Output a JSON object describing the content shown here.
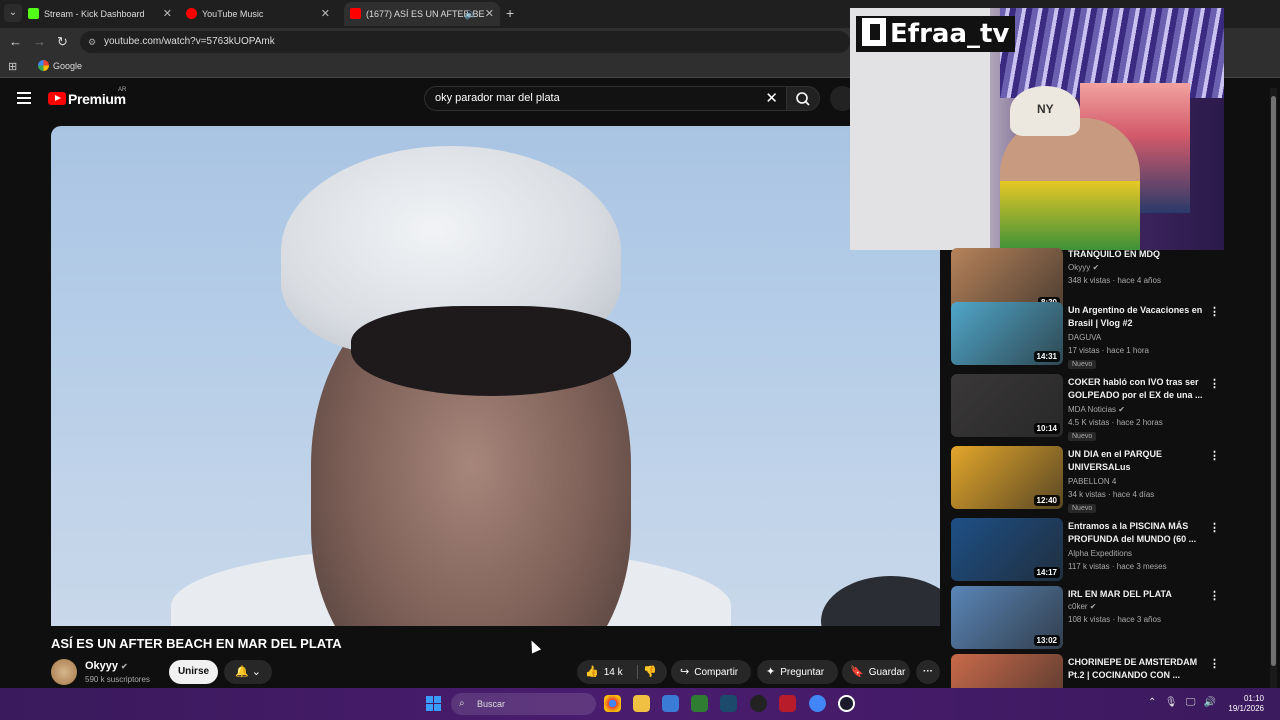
{
  "browser": {
    "tabs": [
      {
        "label": "Stream - Kick Dashboard",
        "color": "#53fc18"
      },
      {
        "label": "YouTube Music",
        "color": "#ff0000"
      },
      {
        "label": "(1677) ASÍ ES UN AFTER BE",
        "color": "#ff0000"
      }
    ],
    "url": "youtube.com/watch?v=5763kUOPAmk",
    "bookmark": "Google"
  },
  "youtube": {
    "logo_text": "Premium",
    "region": "AR",
    "search_query": "oky parador mar del plata"
  },
  "overlay": {
    "streamer_name": "Efraa_tv",
    "cap_logo": "NY"
  },
  "video": {
    "title": "ASÍ ES UN AFTER BEACH EN MAR DEL PLATA",
    "channel": "Okyyy",
    "subscribers": "590 k suscriptores",
    "join_label": "Unirse",
    "likes": "14 k",
    "share_label": "Compartir",
    "ask_label": "Preguntar",
    "save_label": "Guardar"
  },
  "recommendations": [
    {
      "title": "TRANQUILO EN MDQ",
      "channel": "Okyyy",
      "verified": true,
      "stats": "348 k vistas · hace 4 años",
      "duration": "8:30",
      "badge": "",
      "thumb": "#b7835a"
    },
    {
      "title": "Un Argentino de Vacaciones en Brasil | Vlog #2",
      "channel": "DAGUVA",
      "verified": false,
      "stats": "17 vistas · hace 1 hora",
      "duration": "14:31",
      "badge": "Nuevo",
      "thumb": "#4fa6c9"
    },
    {
      "title": "COKER habló con IVO tras ser GOLPEADO por el EX de una ...",
      "channel": "MDA Noticias",
      "verified": true,
      "stats": "4.5 K vistas · hace 2 horas",
      "duration": "10:14",
      "badge": "Nuevo",
      "thumb": "#3a3838"
    },
    {
      "title": "UN DIA en el PARQUE UNIVERSALus",
      "channel": "PABELLON 4",
      "verified": false,
      "stats": "34 k vistas · hace 4 días",
      "duration": "12:40",
      "badge": "Nuevo",
      "thumb": "#e3a62a"
    },
    {
      "title": "Entramos a la PISCINA MÁS PROFUNDA del MUNDO (60 ...",
      "channel": "Alpha Expeditions",
      "verified": false,
      "stats": "117 k vistas · hace 3 meses",
      "duration": "14:17",
      "badge": "",
      "thumb": "#1d4f86"
    },
    {
      "title": "IRL EN MAR DEL PLATA",
      "channel": "c0ker",
      "verified": true,
      "stats": "108 k vistas · hace 3 años",
      "duration": "13:02",
      "badge": "",
      "thumb": "#5a86b8"
    },
    {
      "title": "CHORINEPE DE AMSTERDAM Pt.2 | COCINANDO CON ...",
      "channel": "",
      "verified": false,
      "stats": "",
      "duration": "",
      "badge": "",
      "thumb": "#c96a4a"
    }
  ],
  "taskbar": {
    "search_label": "Buscar",
    "time": "01:10",
    "date": "19/1/2026"
  }
}
